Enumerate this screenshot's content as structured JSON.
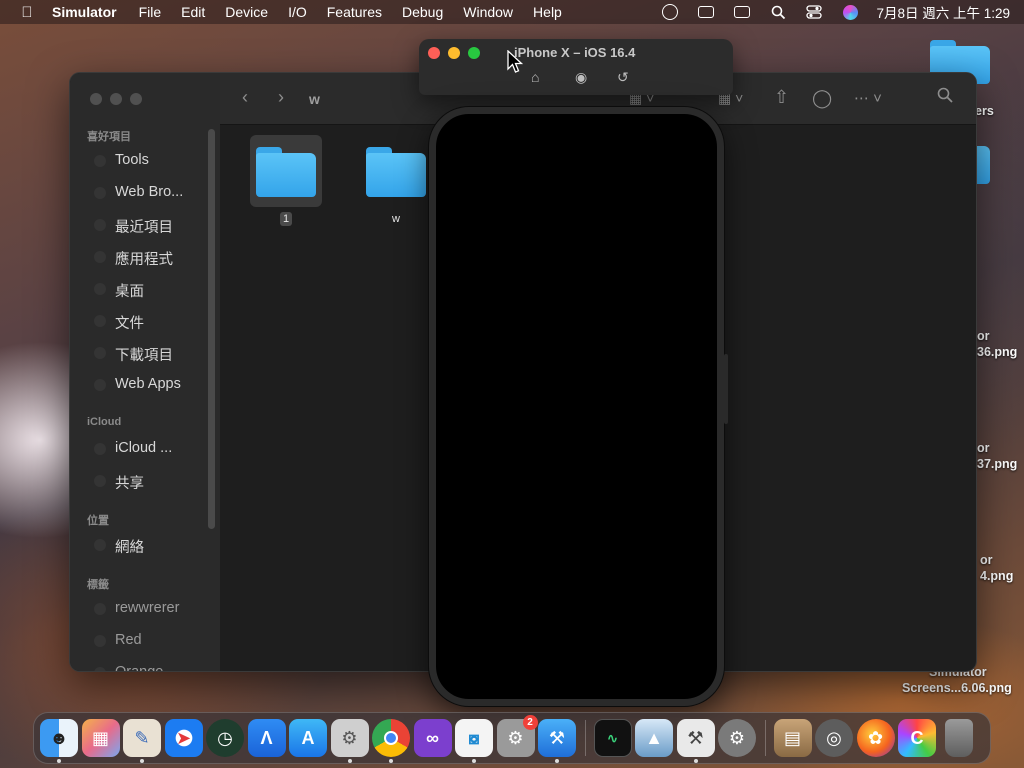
{
  "menubar": {
    "app_name": "Simulator",
    "menus": [
      "File",
      "Edit",
      "Device",
      "I/O",
      "Features",
      "Debug",
      "Window",
      "Help"
    ],
    "clock": "7月8日 週六 上午 1:29",
    "status_icons": [
      "screen-record-icon",
      "airplay-icon",
      "stage-manager-icon",
      "search-icon",
      "control-center-icon",
      "siri-icon"
    ]
  },
  "desktop": {
    "items": [
      {
        "label": "ers"
      },
      {
        "label": "or"
      },
      {
        "label": "36.png"
      },
      {
        "label": "or"
      },
      {
        "label": "37.png"
      },
      {
        "label": "or"
      },
      {
        "label": "4.png"
      },
      {
        "label": "Simulator"
      },
      {
        "label": "Screens...6.06.png"
      }
    ]
  },
  "finder": {
    "path_title": "w",
    "sidebar": {
      "favorites_header": "喜好項目",
      "favorites": [
        "Tools",
        "Web Bro...",
        "最近項目",
        "應用程式",
        "桌面",
        "文件",
        "下載項目",
        "Web Apps"
      ],
      "icloud_header": "iCloud",
      "icloud": [
        "iCloud ...",
        "共享"
      ],
      "locations_header": "位置",
      "locations": [
        "網絡"
      ],
      "tags_header": "標籤",
      "tags": [
        "rewwrerer",
        "Red",
        "Orange"
      ]
    },
    "files": [
      {
        "name": "1"
      },
      {
        "name": "w"
      }
    ]
  },
  "simulator": {
    "title": "iPhone X – iOS 16.4",
    "tools": [
      "home-icon",
      "screenshot-icon",
      "rotate-icon"
    ]
  },
  "dock": {
    "apps": [
      "finder-icon",
      "launchpad-icon",
      "textedit-icon",
      "safari-icon",
      "time-machine-icon",
      "appstore-connect-icon",
      "app-store-icon",
      "automator-icon",
      "chrome-icon",
      "visual-studio-icon",
      "vscode-icon",
      "system-settings-icon",
      "xcode-icon"
    ],
    "settings_badge": "2",
    "others": [
      "activity-monitor-icon",
      "preview-icon",
      "instruments-icon",
      "settings-icon",
      "archive-icon",
      "disk-utility-icon",
      "firefox-icon",
      "color-picker-icon",
      "trash-icon"
    ]
  }
}
